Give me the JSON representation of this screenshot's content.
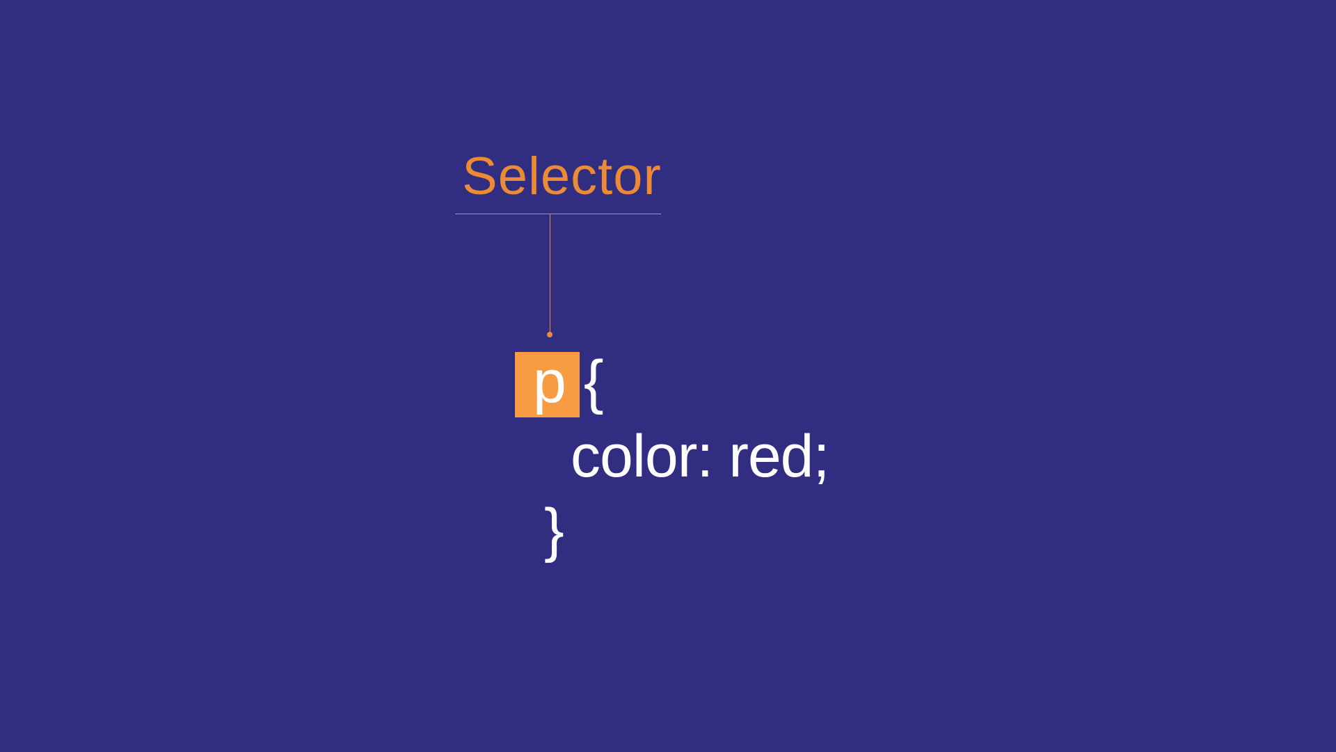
{
  "labels": {
    "selector": "Selector"
  },
  "code": {
    "selector": "p",
    "open_brace": "{",
    "declaration": "color: red;",
    "close_brace": "}"
  },
  "colors": {
    "background": "#312e81",
    "accent": "#ed8a35",
    "highlight": "#f89c44",
    "text": "#ffffff"
  }
}
